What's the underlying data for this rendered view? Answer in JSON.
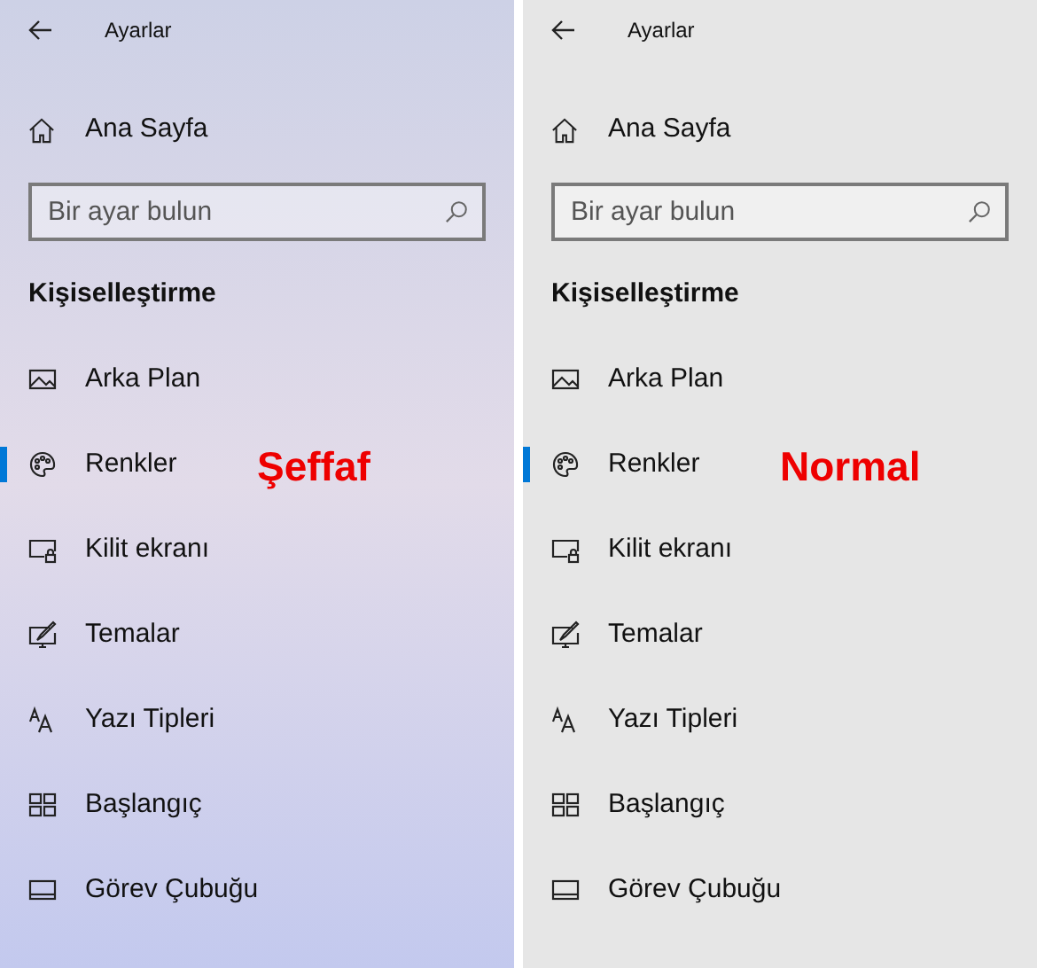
{
  "panels": [
    {
      "kind": "acrylic",
      "title": "Ayarlar",
      "home": "Ana Sayfa",
      "search": {
        "placeholder": "Bir ayar bulun"
      },
      "section": "Kişiselleştirme",
      "label": "Şeffaf",
      "items": [
        {
          "label": "Arka Plan",
          "selected": false
        },
        {
          "label": "Renkler",
          "selected": true
        },
        {
          "label": "Kilit ekranı",
          "selected": false
        },
        {
          "label": "Temalar",
          "selected": false
        },
        {
          "label": "Yazı Tipleri",
          "selected": false
        },
        {
          "label": "Başlangıç",
          "selected": false
        },
        {
          "label": "Görev Çubuğu",
          "selected": false
        }
      ]
    },
    {
      "kind": "solid",
      "title": "Ayarlar",
      "home": "Ana Sayfa",
      "search": {
        "placeholder": "Bir ayar bulun"
      },
      "section": "Kişiselleştirme",
      "label": "Normal",
      "items": [
        {
          "label": "Arka Plan",
          "selected": false
        },
        {
          "label": "Renkler",
          "selected": true
        },
        {
          "label": "Kilit ekranı",
          "selected": false
        },
        {
          "label": "Temalar",
          "selected": false
        },
        {
          "label": "Yazı Tipleri",
          "selected": false
        },
        {
          "label": "Başlangıç",
          "selected": false
        },
        {
          "label": "Görev Çubuğu",
          "selected": false
        }
      ]
    }
  ]
}
